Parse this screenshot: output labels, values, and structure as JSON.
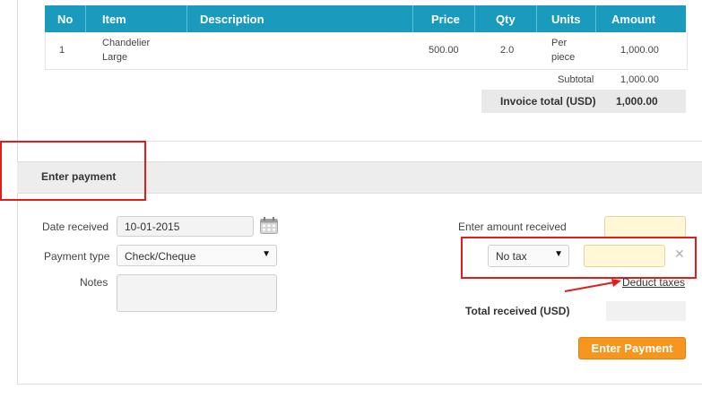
{
  "table": {
    "headers": [
      "No",
      "Item",
      "Description",
      "Price",
      "Qty",
      "Units",
      "Amount"
    ],
    "row": {
      "no": "1",
      "item_line1": "Chandelier",
      "item_line2": "Large",
      "description": "",
      "price": "500.00",
      "qty": "2.0",
      "units_line1": "Per",
      "units_line2": "piece",
      "amount": "1,000.00"
    },
    "subtotal_label": "Subtotal",
    "subtotal_value": "1,000.00",
    "invoice_total_label": "Invoice total (USD)",
    "invoice_total_value": "1,000.00"
  },
  "payment": {
    "section_title": "Enter payment",
    "date_label": "Date received",
    "date_value": "10-01-2015",
    "payment_type_label": "Payment type",
    "payment_type_value": "Check/Cheque",
    "notes_label": "Notes",
    "notes_value": "",
    "amount_label": "Enter amount received",
    "amount_value": "",
    "tax_select_value": "No tax",
    "tax_amount_value": "",
    "deduct_taxes_link": "Deduct taxes",
    "total_received_label": "Total received (USD)",
    "total_received_value": "",
    "submit_button": "Enter Payment"
  },
  "icons": {
    "calendar": "calendar-icon",
    "close": "close-icon",
    "dropdown": "chevron-down-icon"
  },
  "colors": {
    "table_header": "#1a9bbd",
    "highlight_annotation": "#e21b1b",
    "button": "#f7961e",
    "yellow_input": "#fff7d6"
  }
}
